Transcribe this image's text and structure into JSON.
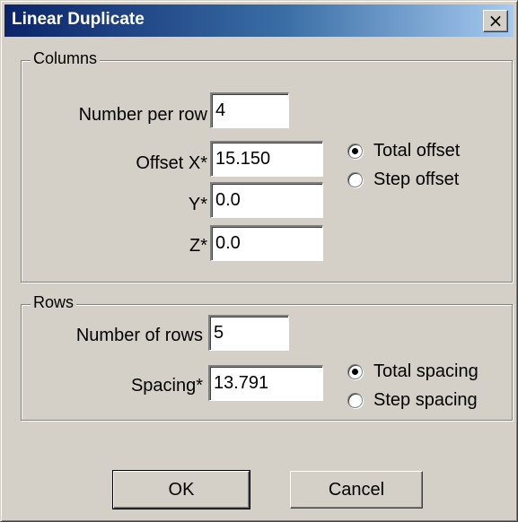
{
  "window": {
    "title": "Linear Duplicate",
    "close_icon": "×"
  },
  "columns": {
    "legend": "Columns",
    "number_per_row_label": "Number per row",
    "number_per_row_value": "4",
    "offset_x_label": "Offset X*",
    "offset_x_value": "15.150",
    "y_label": "Y*",
    "y_value": "0.0",
    "z_label": "Z*",
    "z_value": "0.0",
    "total_offset_label": "Total offset",
    "step_offset_label": "Step offset",
    "selected_offset_mode": "total"
  },
  "rows": {
    "legend": "Rows",
    "number_of_rows_label": "Number of rows",
    "number_of_rows_value": "5",
    "spacing_label": "Spacing*",
    "spacing_value": "13.791",
    "total_spacing_label": "Total spacing",
    "step_spacing_label": "Step spacing",
    "selected_spacing_mode": "total"
  },
  "buttons": {
    "ok_label": "OK",
    "cancel_label": "Cancel"
  }
}
